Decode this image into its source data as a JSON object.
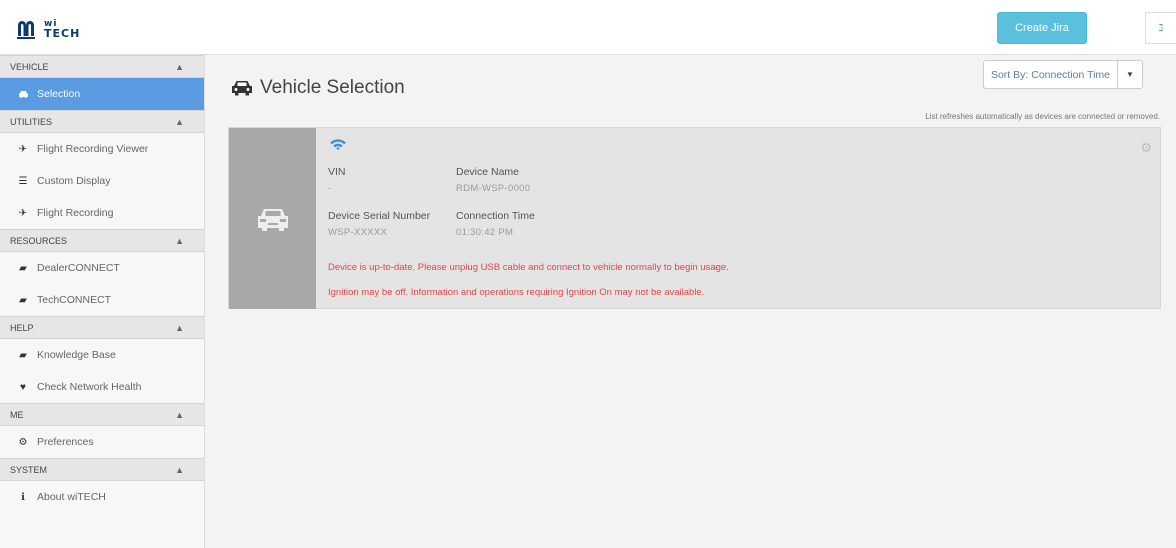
{
  "header": {
    "logo_top": "wi",
    "logo_bottom": "TECH",
    "create_jira": "Create Jira",
    "rss_icon": "rss-icon",
    "accent": "#5bc0de"
  },
  "sidebar": {
    "sections": [
      {
        "title": "VEHICLE",
        "items": [
          {
            "label": "Selection",
            "icon": "car-icon",
            "active": true
          }
        ]
      },
      {
        "title": "UTILITIES",
        "items": [
          {
            "label": "Flight Recording Viewer",
            "icon": "plane-icon"
          },
          {
            "label": "Custom Display",
            "icon": "list-icon"
          },
          {
            "label": "Flight Recording",
            "icon": "plane-icon"
          }
        ]
      },
      {
        "title": "RESOURCES",
        "items": [
          {
            "label": "DealerCONNECT",
            "icon": "book-icon"
          },
          {
            "label": "TechCONNECT",
            "icon": "book-icon"
          }
        ]
      },
      {
        "title": "HELP",
        "items": [
          {
            "label": "Knowledge Base",
            "icon": "book-icon"
          },
          {
            "label": "Check Network Health",
            "icon": "heartbeat-icon"
          }
        ]
      },
      {
        "title": "ME",
        "items": [
          {
            "label": "Preferences",
            "icon": "preferences-icon"
          }
        ]
      },
      {
        "title": "SYSTEM",
        "items": [
          {
            "label": "About wiTECH",
            "icon": "info-icon"
          }
        ]
      }
    ],
    "active_color": "#5a9be2"
  },
  "main": {
    "title": "Vehicle Selection",
    "sort_label": "Sort By: Connection Time",
    "refresh_note": "List refreshes automatically as devices are connected or removed.",
    "device": {
      "vin_label": "VIN",
      "vin_value": "-",
      "device_name_label": "Device Name",
      "device_name_value": "RDM-WSP-0000",
      "serial_label": "Device Serial Number",
      "serial_value": "WSP-XXXXX",
      "connection_time_label": "Connection Time",
      "connection_time_value": "01:30:42 PM",
      "message_1": "Device is up-to-date. Please unplug USB cable and connect to vehicle normally to begin usage.",
      "message_2": "Ignition may be off. Information and operations requiring Ignition On may not be available.",
      "error_color": "#e04848"
    }
  }
}
